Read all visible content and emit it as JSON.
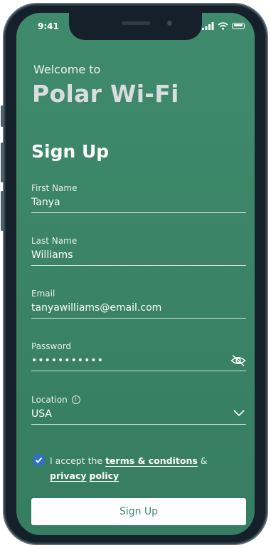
{
  "status_bar": {
    "time": "9:41"
  },
  "header": {
    "welcome": "Welcome to",
    "app_name": "Polar Wi-Fi"
  },
  "form": {
    "title": "Sign Up",
    "first_name": {
      "label": "First Name",
      "value": "Tanya"
    },
    "last_name": {
      "label": "Last Name",
      "value": "Williams"
    },
    "email": {
      "label": "Email",
      "value": "tanyawilliams@email.com"
    },
    "password": {
      "label": "Password",
      "value": "•••••••••••"
    },
    "location": {
      "label": "Location",
      "value": "USA"
    },
    "terms": {
      "prefix": "I accept the",
      "terms_link": "terms & conditons",
      "joiner": "&",
      "privacy_link_1": "privacy",
      "privacy_link_2": "policy",
      "checked": true
    },
    "submit_label": "Sign Up"
  },
  "colors": {
    "background": "#3b8467",
    "button_text": "#3f8a6d",
    "checkbox": "#2f6fd0"
  },
  "icons": [
    "signal-icon",
    "wifi-icon",
    "battery-icon",
    "eye-off-icon",
    "info-icon",
    "chevron-down-icon",
    "checkmark-icon"
  ]
}
